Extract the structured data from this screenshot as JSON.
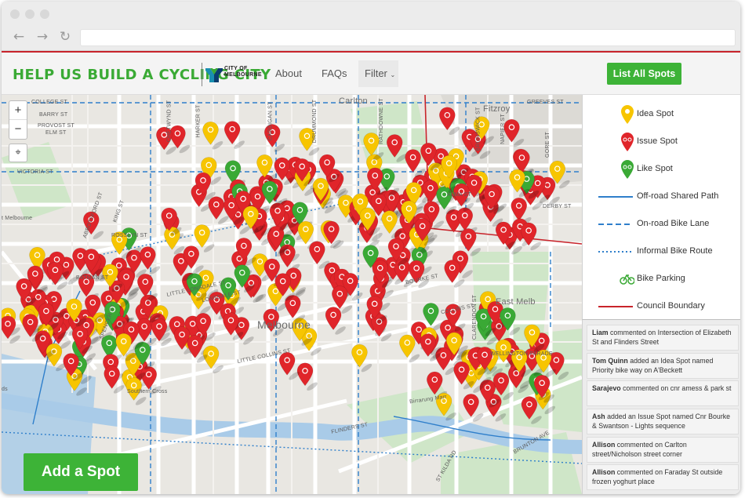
{
  "site": {
    "title": "HELP US BUILD A CYCLING CITY",
    "logo_text_line1": "CITY OF",
    "logo_text_line2": "MELBOURNE"
  },
  "nav": {
    "items": [
      {
        "label": "About"
      },
      {
        "label": "FAQs"
      },
      {
        "label": "Filter"
      }
    ],
    "list_all_label": "List All Spots"
  },
  "map": {
    "zoom_in": "+",
    "zoom_out": "−",
    "street_labels": [
      "COLLEGE ST",
      "BARRY ST",
      "PROVOST ST",
      "ELM ST",
      "VICTORIA ST",
      "CHETWYND ST",
      "HARKER ST",
      "CARDIGAN ST",
      "DRUMMOND ST",
      "RATHDOWNE ST",
      "KING ST",
      "BATMAN ST",
      "ROSSLYN ST",
      "ABBOTSFORD ST",
      "SPENCER ST",
      "FLINDERS ST",
      "LITTLE LONSDALE ST",
      "LONSDALE ST",
      "BOURKE ST",
      "COLLINS ST",
      "LITTLE COLLINS ST",
      "WELLINGTON PARADE",
      "ALMA ST",
      "DERBY ST",
      "GREEVES ST",
      "BRUNSWICK ST",
      "NAPIER ST",
      "GORE ST",
      "BRUNTON AVE",
      "CLARENDON ST",
      "ST KILDA RD"
    ],
    "place_labels": {
      "melbourne": "Melbourne",
      "east_melbourne": "East Melb",
      "carlton": "Carlton",
      "fitzroy": "Fitzroy",
      "southern_cross": "Southern Cross",
      "birrarung": "Birrarung Marr",
      "west_melbourne": "t Melbourne",
      "docklands": "ds"
    },
    "add_spot_label": "Add a Spot"
  },
  "legend": {
    "items": [
      {
        "label": "Idea Spot",
        "type": "pin",
        "color": "#f7c500",
        "icon": "lightbulb-icon"
      },
      {
        "label": "Issue Spot",
        "type": "pin",
        "color": "#e0252a",
        "icon": "bicycle-icon"
      },
      {
        "label": "Like Spot",
        "type": "pin",
        "color": "#3aa935",
        "icon": "bicycle-icon"
      },
      {
        "label": "Off-road Shared Path",
        "type": "line",
        "color": "#2f7fcb",
        "style": "solid"
      },
      {
        "label": "On-road Bike Lane",
        "type": "line",
        "color": "#2f7fcb",
        "style": "dashed"
      },
      {
        "label": "Informal Bike Route",
        "type": "line",
        "color": "#2f7fcb",
        "style": "dotted"
      },
      {
        "label": "Bike Parking",
        "type": "icon",
        "color": "#3aa935",
        "icon": "bike-parking-icon"
      },
      {
        "label": "Council Boundary",
        "type": "line",
        "color": "#c8242b",
        "style": "solid"
      }
    ]
  },
  "feed": [
    {
      "name": "Liam",
      "text": " commented on Intersection of Elizabeth St and Flinders Street"
    },
    {
      "name": "Tom Quinn",
      "text": " added an Idea Spot named Priority bike way on A'Beckett"
    },
    {
      "name": "Sarajevo",
      "text": " commented on cnr amess & park st"
    },
    {
      "name": "Ash",
      "text": " added an Issue Spot named Cnr Bourke & Swantson - Lights sequence"
    },
    {
      "name": "Allison",
      "text": " commented on Carlton street/Nicholson street corner"
    },
    {
      "name": "Allison",
      "text": " commented on Faraday St outside frozen yoghurt place"
    }
  ],
  "colors": {
    "brand_green": "#3aaa35",
    "button_green": "#3db337",
    "issue_red": "#e0252a",
    "idea_yellow": "#f7c500",
    "like_green": "#3aa935",
    "path_blue": "#2f7fcb",
    "boundary_red": "#c8242b"
  }
}
